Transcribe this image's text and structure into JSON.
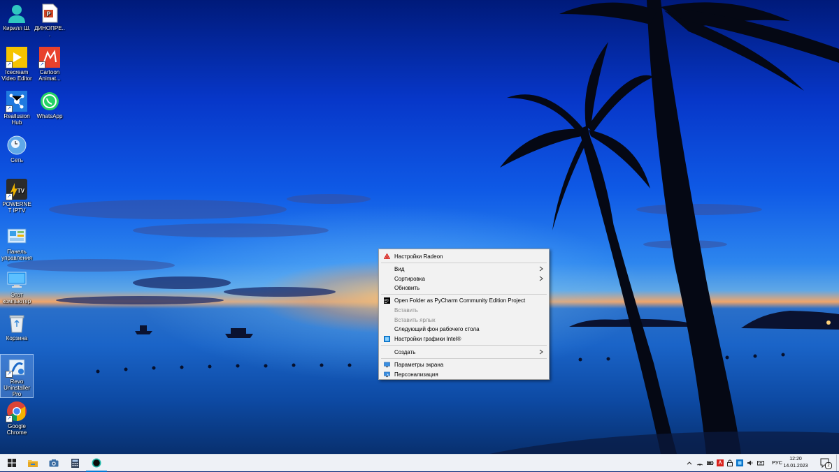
{
  "desktop": {
    "icons": [
      {
        "label": "Кирилл Ш."
      },
      {
        "label": "ДИНОПРЕ..."
      },
      {
        "label": "Icecream Video Editor"
      },
      {
        "label": "Cartoon Animat..."
      },
      {
        "label": "Reallusion Hub"
      },
      {
        "label": "WhatsApp"
      },
      {
        "label": "Сеть"
      },
      {
        "label": "POWERNET IPTV"
      },
      {
        "label": "Панель управления"
      },
      {
        "label": "Этот компьютер"
      },
      {
        "label": "Корзина"
      },
      {
        "label": "Revo Uninstaller Pro"
      },
      {
        "label": "Google Chrome"
      }
    ]
  },
  "context_menu": {
    "items": [
      {
        "label": "Настройки Radeon",
        "icon": "radeon-icon"
      },
      {
        "label": "Вид",
        "submenu": true
      },
      {
        "label": "Сортировка",
        "submenu": true
      },
      {
        "label": "Обновить"
      },
      {
        "label": "Open Folder as PyCharm Community Edition Project",
        "icon": "pycharm-icon"
      },
      {
        "label": "Вставить",
        "disabled": true
      },
      {
        "label": "Вставить ярлык",
        "disabled": true
      },
      {
        "label": "Следующий фон рабочего стола"
      },
      {
        "label": "Настройки графики Intel®",
        "icon": "intel-graphics-icon"
      },
      {
        "label": "Создать",
        "submenu": true
      },
      {
        "label": "Параметры экрана",
        "icon": "display-settings-icon"
      },
      {
        "label": "Персонализация",
        "icon": "personalization-icon"
      }
    ]
  },
  "taskbar": {
    "language": "РУС",
    "time": "12:20",
    "date": "14.01.2023",
    "notifications_count": "2"
  },
  "colors": {
    "menu_bg": "#f2f2f2",
    "taskbar_bg": "#eef1f6",
    "accent": "#0078d7"
  }
}
